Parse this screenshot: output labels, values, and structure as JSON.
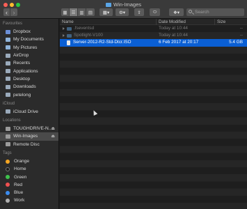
{
  "window": {
    "title": "Win-Images",
    "folder_icon": "folder-icon",
    "back_glyph": "‹",
    "forward_glyph": "›",
    "search_placeholder": "Search"
  },
  "toolbar": {
    "view_glyphs": [
      "▦",
      "☰",
      "▥",
      "▤"
    ],
    "arrange_glyph": "▦▾",
    "action_glyph": "⚙▾",
    "share_glyph": "⇧",
    "tags_glyph": "⬭",
    "dropbox_glyph": "❖▾"
  },
  "sidebar": {
    "favourites_title": "Favourites",
    "favourites": [
      {
        "label": "Dropbox",
        "icon": "dropbox-icon",
        "color": "#6b8fd6"
      },
      {
        "label": "My Documents",
        "icon": "folder-icon",
        "color": "#8fb3d9"
      },
      {
        "label": "My Pictures",
        "icon": "folder-icon",
        "color": "#8fb3d9"
      },
      {
        "label": "AirDrop",
        "icon": "airdrop-icon",
        "color": "#9aaabb"
      },
      {
        "label": "Recents",
        "icon": "clock-icon",
        "color": "#9aaabb"
      },
      {
        "label": "Applications",
        "icon": "applications-icon",
        "color": "#9aaabb"
      },
      {
        "label": "Desktop",
        "icon": "desktop-icon",
        "color": "#9aaabb"
      },
      {
        "label": "Downloads",
        "icon": "downloads-icon",
        "color": "#9aaabb"
      },
      {
        "label": "petelong",
        "icon": "home-icon",
        "color": "#9aaabb"
      }
    ],
    "icloud_title": "iCloud",
    "icloud": [
      {
        "label": "iCloud Drive",
        "icon": "cloud-icon",
        "color": "#9aaabb"
      }
    ],
    "locations_title": "Locations",
    "locations": [
      {
        "label": "TOUGHDRIVE-N...",
        "icon": "drive-icon",
        "color": "#9a9a9a",
        "eject": "⏏"
      },
      {
        "label": "Win-Images",
        "icon": "drive-icon",
        "color": "#9a9a9a",
        "eject": "⏏"
      },
      {
        "label": "Remote Disc",
        "icon": "disc-icon",
        "color": "#9a9a9a"
      }
    ],
    "tags_title": "Tags",
    "tags": [
      {
        "label": "Orange",
        "color": "#f5a623"
      },
      {
        "label": "Home",
        "color": "#1a1a1a"
      },
      {
        "label": "Green",
        "color": "#3fc24d"
      },
      {
        "label": "Red",
        "color": "#f05050"
      },
      {
        "label": "Blue",
        "color": "#3b8cf0"
      },
      {
        "label": "Work",
        "color": "#b0b0b0"
      }
    ]
  },
  "columns": {
    "name": "Name",
    "date": "Date Modified",
    "size": "Size"
  },
  "files": [
    {
      "name": ".fseventsd",
      "date": "Today at 10:44",
      "size": "--",
      "kind": "folder"
    },
    {
      "name": "Spotlight-V100",
      "date": "Today at 10:44",
      "size": "--",
      "kind": "folder"
    },
    {
      "name": "Server-2012-R2-Std-Dtcr.ISO",
      "date": "6 Feb 2017 at 20:17",
      "size": "5.4 GB",
      "kind": "file",
      "selected": true
    }
  ]
}
